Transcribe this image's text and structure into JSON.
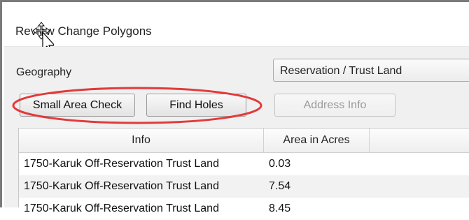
{
  "window": {
    "title": "Review Change Polygons"
  },
  "geography": {
    "label": "Geography",
    "selected": "Reservation / Trust Land"
  },
  "buttons": {
    "small_area_check": "Small Area Check",
    "find_holes": "Find Holes",
    "address_info": "Address Info"
  },
  "grid": {
    "columns": [
      "Info",
      "Area in Acres"
    ],
    "rows": [
      {
        "info": "1750-Karuk Off-Reservation Trust Land",
        "area": "0.03"
      },
      {
        "info": "1750-Karuk Off-Reservation Trust Land",
        "area": "7.54"
      },
      {
        "info": "1750-Karuk Off-Reservation Trust Land",
        "area": "8.45"
      }
    ]
  },
  "colors": {
    "highlight_ellipse": "#e23a3a",
    "disabled_text": "#9a9a9a"
  }
}
